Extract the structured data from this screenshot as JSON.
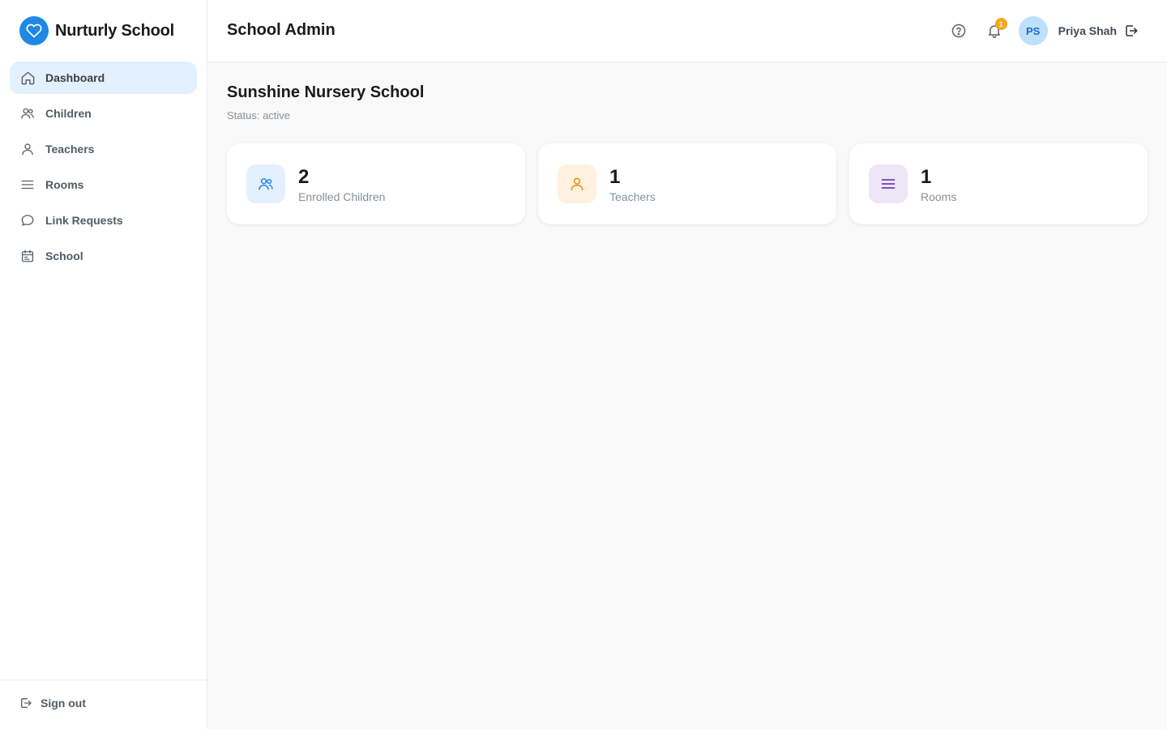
{
  "brand": {
    "name": "Nurturly School",
    "logo_icon": "heart-icon",
    "accent": "#1e88e5"
  },
  "sidebar": {
    "items": [
      {
        "label": "Dashboard",
        "icon": "home-icon",
        "active": true
      },
      {
        "label": "Children",
        "icon": "users-icon",
        "active": false
      },
      {
        "label": "Teachers",
        "icon": "user-icon",
        "active": false
      },
      {
        "label": "Rooms",
        "icon": "menu-lines-icon",
        "active": false
      },
      {
        "label": "Link Requests",
        "icon": "chat-bubble-icon",
        "active": false
      },
      {
        "label": "School",
        "icon": "calendar-icon",
        "active": false
      }
    ],
    "sign_out_label": "Sign out"
  },
  "header": {
    "title": "School Admin",
    "notification_count": "1",
    "user": {
      "initials": "PS",
      "name": "Priya Shah"
    }
  },
  "school": {
    "name": "Sunshine Nursery School",
    "status": "Status: active"
  },
  "stats": [
    {
      "value": "2",
      "label": "Enrolled Children",
      "icon": "users-icon",
      "color": "#1e88e5",
      "bg": "#e3f0fd"
    },
    {
      "value": "1",
      "label": "Teachers",
      "icon": "user-icon",
      "color": "#f08c00",
      "bg": "#fff1de"
    },
    {
      "value": "1",
      "label": "Rooms",
      "icon": "menu-lines-icon",
      "color": "#6a3fb5",
      "bg": "#ede6f7"
    }
  ]
}
